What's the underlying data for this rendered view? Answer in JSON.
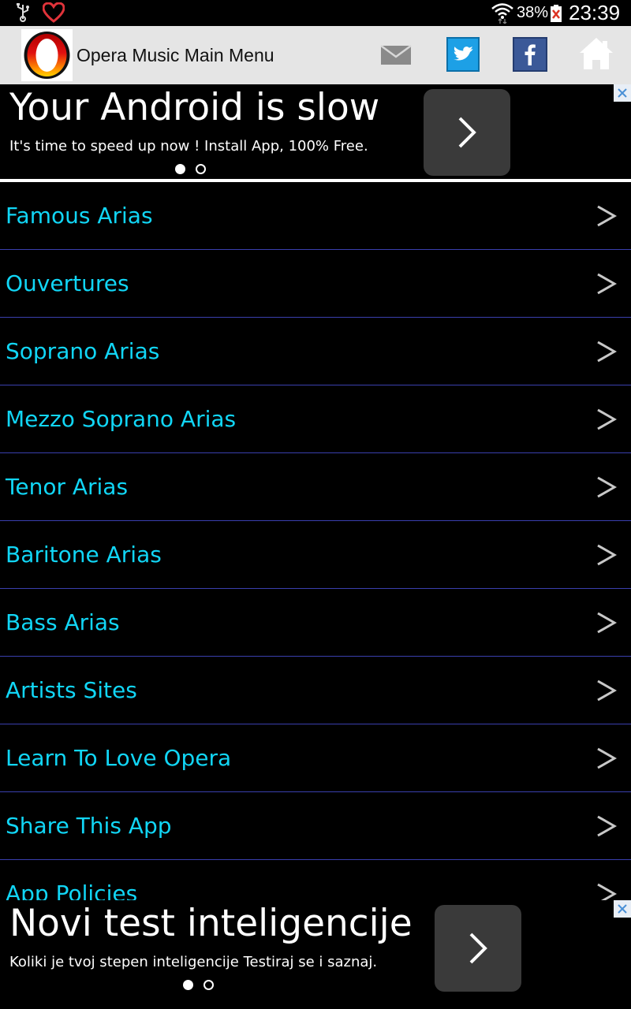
{
  "status_bar": {
    "battery_percent": "38%",
    "time": "23:39"
  },
  "header": {
    "title": "Opera Music Main Menu",
    "logo_letter": "O"
  },
  "ad_top": {
    "headline": "Your Android is slow",
    "subtext": "It's time to speed up now ! Install App, 100% Free."
  },
  "menu": {
    "items": [
      {
        "label": "Famous Arias"
      },
      {
        "label": "Ouvertures"
      },
      {
        "label": "Soprano Arias"
      },
      {
        "label": "Mezzo Soprano Arias"
      },
      {
        "label": "Tenor Arias"
      },
      {
        "label": "Baritone Arias"
      },
      {
        "label": "Bass Arias"
      },
      {
        "label": "Artists Sites"
      },
      {
        "label": "Learn To Love Opera"
      },
      {
        "label": "Share This App"
      },
      {
        "label": "App Policies"
      }
    ]
  },
  "ad_bottom": {
    "headline": "Novi test inteligencije",
    "subtext": "Koliki je tvoj stepen inteligencije Testiraj se i saznaj."
  },
  "colors": {
    "menu_text": "#11d6f6",
    "divider": "#3a3fae",
    "header_bg": "#e5e5e5"
  }
}
